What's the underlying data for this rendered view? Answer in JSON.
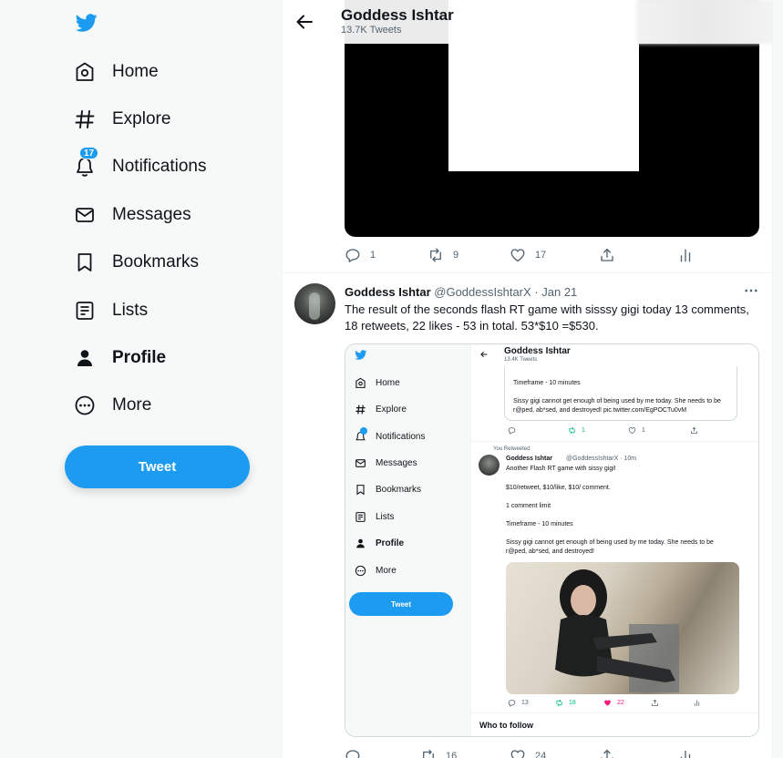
{
  "colors": {
    "accent": "#1d9bf0",
    "text": "#0f1419",
    "muted": "#536471",
    "like": "#f91880",
    "retweet": "#00ba7c"
  },
  "sidebar": {
    "logo_icon": "twitter-bird-icon",
    "items": [
      {
        "label": "Home",
        "icon": "home-icon"
      },
      {
        "label": "Explore",
        "icon": "hashtag-icon"
      },
      {
        "label": "Notifications",
        "icon": "bell-icon",
        "badge": "17"
      },
      {
        "label": "Messages",
        "icon": "envelope-icon"
      },
      {
        "label": "Bookmarks",
        "icon": "bookmark-icon"
      },
      {
        "label": "Lists",
        "icon": "list-icon"
      },
      {
        "label": "Profile",
        "icon": "person-icon",
        "active": true
      },
      {
        "label": "More",
        "icon": "more-circle-icon"
      }
    ],
    "tweet_button": "Tweet"
  },
  "header": {
    "title": "Goddess Ishtar",
    "subtitle": "13.7K Tweets"
  },
  "tweet1": {
    "actions": {
      "replies": "1",
      "retweets": "9",
      "likes": "17"
    }
  },
  "tweet2": {
    "name": "Goddess Ishtar",
    "handle": "@GoddessIshtarX",
    "date": "· Jan 21",
    "text": "The result of the seconds flash RT game with sisssy gigi today 13 comments, 18 retweets, 22 likes - 53 in total. 53*$10 =$530.",
    "embedded": {
      "sidebar_items": [
        "Home",
        "Explore",
        "Notifications",
        "Messages",
        "Bookmarks",
        "Lists",
        "Profile",
        "More"
      ],
      "tweet_button": "Tweet",
      "header_title": "Goddess Ishtar",
      "header_sub": "13.4K Tweets",
      "quote_line1": "Timeframe - 10 minutes",
      "quote_line2": "Sissy gigi cannot get enough of being used by me today. She needs to be",
      "quote_line3": "r@ped, ab*sed, and destroyed! pic.twitter.com/EgPOCTu0vM",
      "quote_rt": "1",
      "quote_like": "1",
      "retweeted_label": "You Retweeted",
      "inner_name": "Goddess Ishtar",
      "inner_handle": "@GoddessIshtarX · 10m",
      "inner_l1": "Another Flash RT game with sissy gigi!",
      "inner_l2": "$10/retweet, $10/like, $10/ comment.",
      "inner_l3": "1 comment limit",
      "inner_l4": "Timeframe - 10 minutes",
      "inner_l5": "Sissy gigi cannot get enough of being used by me today. She needs to be",
      "inner_l6": "r@ped, ab*sed, and destroyed!",
      "inner_replies": "13",
      "inner_retweets": "18",
      "inner_likes": "22",
      "who_to_follow": "Who to follow"
    },
    "actions": {
      "replies": "",
      "retweets": "16",
      "likes": "24"
    }
  }
}
